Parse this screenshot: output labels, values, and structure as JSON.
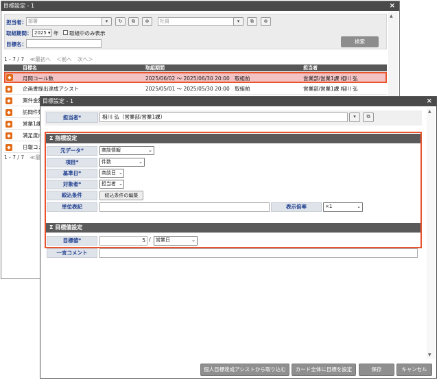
{
  "back_window": {
    "title": "目標設定 - 1",
    "close": "×",
    "filter": {
      "assignee_label": "担当者：",
      "dept_placeholder": "部署",
      "staff_placeholder": "社員",
      "period_label": "取組期間：",
      "period_value": "2025",
      "year_suffix": "年",
      "in_progress_label": "取組中のみ表示",
      "goal_name_label": "目標名：",
      "search_button": "検索"
    },
    "pager": {
      "count": "1 - 7 / 7",
      "first": "≪最初へ",
      "prev": "＜前へ",
      "next": "次へ＞"
    },
    "table": {
      "headers": [
        "目標名",
        "取組期間",
        "担当者"
      ],
      "rows": [
        {
          "name": "月間コール数",
          "period": "2025/06/02 ～ 2025/06/30 20:00",
          "status": "取組前",
          "assignee": "営業部/営業1課 相川 弘"
        },
        {
          "name": "企画書提出達成アシスト",
          "period": "2025/05/01 ～ 2025/05/30 20:00",
          "status": "取組前",
          "assignee": "営業部/営業1課 相川 弘"
        },
        {
          "name": "案件金額"
        },
        {
          "name": "訪問件数"
        },
        {
          "name": "営業1課"
        },
        {
          "name": "満足度向"
        },
        {
          "name": "日報コメ"
        }
      ]
    },
    "footer_count": "1 - 7 / 7",
    "footer_first": "≪最"
  },
  "front_window": {
    "title": "目標設定 - 1",
    "close": "×",
    "assignee_label": "担当者*",
    "assignee_value": "相川 弘（営業部/営業1課）",
    "metric_section": "Σ 指標設定",
    "source_label": "元データ*",
    "source_value": "商談情報",
    "item_label": "項目*",
    "item_value": "件数",
    "base_date_label": "基準日*",
    "base_date_value": "商談日",
    "target_label": "対象者*",
    "target_value": "担当者",
    "filter_label": "絞込条件",
    "filter_button": "絞込条件の編集",
    "unit_label": "単位表記",
    "unit_value": "",
    "scale_label": "表示倍率",
    "scale_value": "×1",
    "goal_section": "Σ 目標値設定",
    "goal_value_label": "目標値*",
    "goal_value": "5",
    "goal_sep": "/",
    "goal_unit": "営業日",
    "comment_label": "一言コメント",
    "comment_value": "",
    "buttons": {
      "import": "個人目標達成アシストから取り込む",
      "set_all": "カード全体に目標を設定",
      "save": "保存",
      "cancel": "キャンセル"
    }
  }
}
